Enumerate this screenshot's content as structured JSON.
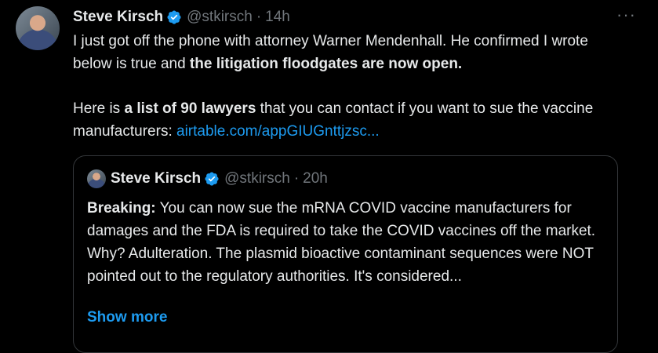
{
  "tweet": {
    "author_name": "Steve Kirsch",
    "handle": "@stkirsch",
    "separator": "·",
    "time": "14h",
    "more_label": "···",
    "para1_prefix": "I just got off the phone with attorney Warner Mendenhall. He confirmed I wrote below is true and ",
    "para1_bold": "the litigation floodgates are now open.",
    "para2_prefix": "Here is ",
    "para2_bold": "a list of 90 lawyers",
    "para2_middle": " that you can contact if you want to sue the vaccine manufacturers: ",
    "link_text": "airtable.com/appGIUGnttjzsc..."
  },
  "quote": {
    "author_name": "Steve Kirsch",
    "handle": "@stkirsch",
    "separator": "·",
    "time": "20h",
    "bold_lead": "Breaking:",
    "text": " You can now sue the mRNA COVID vaccine manufacturers for damages and the FDA is required to take the COVID vaccines off the market. Why? Adulteration. The plasmid bioactive contaminant sequences were NOT pointed out to the regulatory authorities. It's considered...",
    "show_more_label": "Show more"
  },
  "colors": {
    "background": "#000000",
    "text": "#e7e9ea",
    "muted": "#71767b",
    "link": "#1d9bf0",
    "verified": "#1d9bf0",
    "border": "#333639"
  },
  "icons": {
    "verified": "verified-badge-icon",
    "more": "more-options-icon"
  }
}
